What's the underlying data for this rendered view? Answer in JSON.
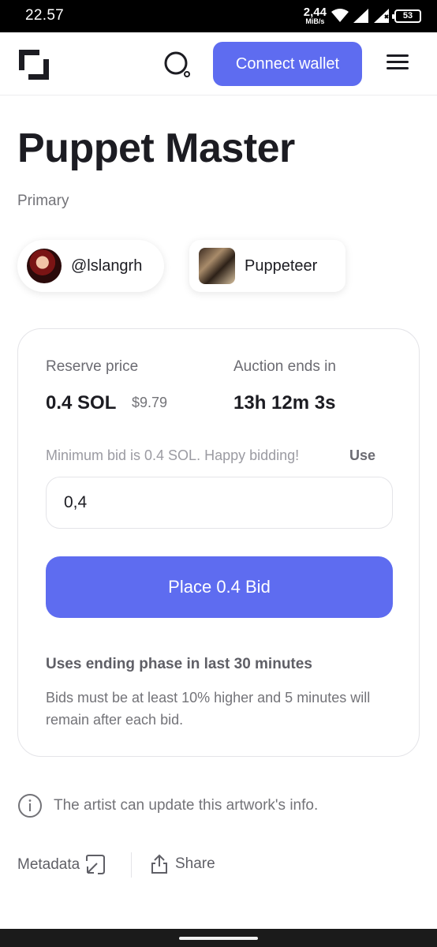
{
  "status_bar": {
    "time": "22.57",
    "net_speed_value": "2,44",
    "net_speed_unit": "MiB/s",
    "battery": "53"
  },
  "header": {
    "logo_icon": "logo-icon",
    "search_icon": "search-icon",
    "connect_label": "Connect wallet",
    "menu_icon": "hamburger-menu-icon",
    "accent_color": "#5e6cf0"
  },
  "artwork": {
    "title": "Puppet Master",
    "subtitle": "Primary"
  },
  "creator": {
    "handle": "@lslangrh"
  },
  "collection": {
    "name": "Puppeteer"
  },
  "auction": {
    "reserve_label": "Reserve price",
    "reserve_value": "0.4 SOL",
    "reserve_usd": "$9.79",
    "ends_label": "Auction ends in",
    "ends_value": "13h 12m 3s",
    "min_bid_text": "Minimum bid is 0.4 SOL. Happy bidding!",
    "use_label": "Use",
    "bid_input_value": "0,4",
    "place_bid_label": "Place 0.4 Bid",
    "phase_title": "Uses ending phase in last 30 minutes",
    "phase_desc": "Bids must be at least 10% higher and 5 minutes will remain after each bid."
  },
  "info": {
    "icon": "info-icon",
    "text": "The artist can update this artwork's info."
  },
  "footer": {
    "metadata_label": "Metadata",
    "metadata_icon": "external-link-icon",
    "share_label": "Share",
    "share_icon": "share-icon"
  }
}
